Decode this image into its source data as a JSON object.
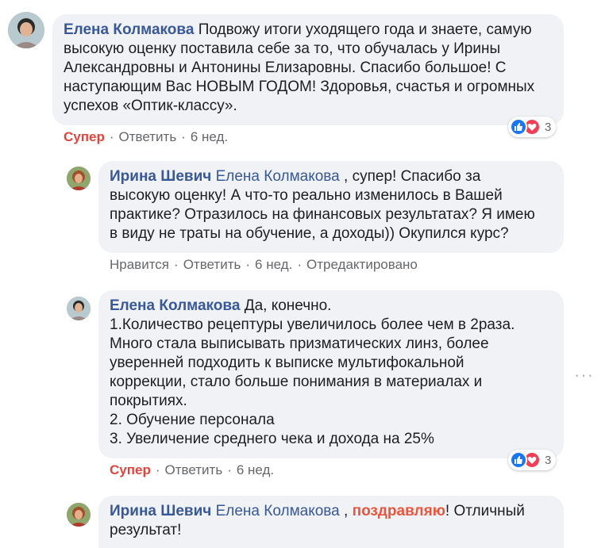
{
  "comments": [
    {
      "author": "Елена Колмакова",
      "text": " Подвожу итоги уходящего года и знаете, самую высокую оценку поставила себе за то, что обучалась у Ирины Александровны и Антонины Елизаровны. Спасибо большое! С наступающим Вас НОВЫМ ГОДОМ! Здоровья, счастья и огромных успехов «Оптик-классу».",
      "lines": [
        "Подвожу итоги уходящего года и знаете, самую",
        "высокую оценку поставила себе за то, что обучалась у Ирины",
        "Александровны и Антонины Елизаровны. Спасибо большое! С",
        "наступающим Вас НОВЫМ ГОДОМ! Здоровья, счастья и огромных",
        "успехов «Оптик-классу»."
      ],
      "actions": {
        "like": "Супер",
        "reply": "Ответить",
        "time": "6 нед."
      },
      "reactions": {
        "count": "3",
        "types": [
          "like-icon",
          "love-icon"
        ]
      }
    },
    {
      "author": "Ирина Шевич",
      "mention": "Елена Колмакова",
      "lines": [
        ", супер! Спасибо за",
        "высокую оценку! А что-то реально изменилось в Вашей",
        "практике? Отразилось на финансовых результатах? Я имею",
        "в виду не траты на обучение, а доходы)) Окупился курс?"
      ],
      "actions": {
        "like": "Нравится",
        "reply": "Ответить",
        "time": "6 нед.",
        "edited": "Отредактировано"
      }
    },
    {
      "author": "Елена Колмакова",
      "lines": [
        "Да, конечно.",
        "1.Количество рецептуры увеличилось более чем в 2раза.",
        "Много стала выписывать призматических линз, более",
        "уверенней подходить к выписке мультифокальной",
        "коррекции, стало больше понимания в материалах и",
        "покрытиях.",
        "2. Обучение персонала",
        "3. Увеличение среднего чека и дохода на 25%"
      ],
      "actions": {
        "like": "Супер",
        "reply": "Ответить",
        "time": "6 нед."
      },
      "reactions": {
        "count": "3",
        "types": [
          "like-icon",
          "love-icon"
        ]
      }
    },
    {
      "author": "Ирина Шевич",
      "mention": "Елена Колмакова",
      "pre_highlight": " , ",
      "highlight": "поздравляю",
      "lines_after": [
        "! Отличный",
        "результат!"
      ]
    }
  ],
  "colors": {
    "author": "#385898",
    "bubble": "#f0f2f5",
    "meta": "#65676b",
    "super": "#e0463e",
    "highlight": "#e9563d"
  }
}
